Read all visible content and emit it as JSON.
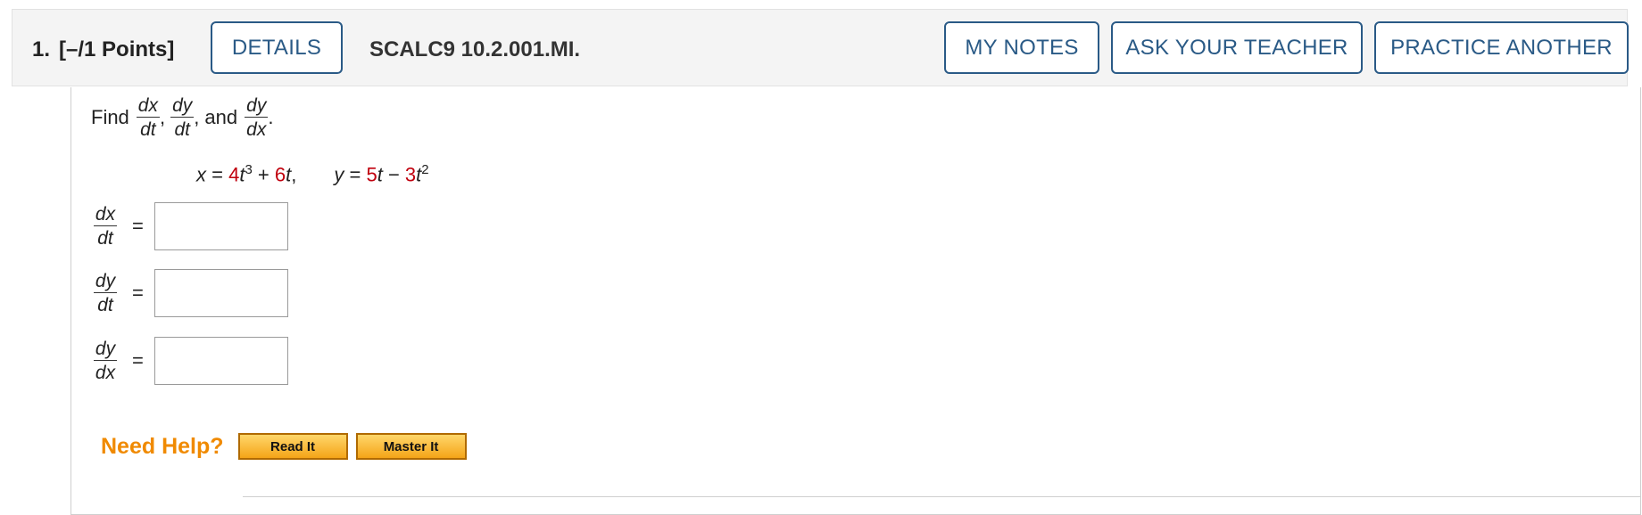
{
  "header": {
    "question_number": "1.",
    "points": "[–/1 Points]",
    "details_label": "DETAILS",
    "question_id": "SCALC9 10.2.001.MI.",
    "my_notes_label": "MY NOTES",
    "ask_teacher_label": "ASK YOUR TEACHER",
    "practice_another_label": "PRACTICE ANOTHER"
  },
  "problem": {
    "find_word": "Find",
    "comma": ",",
    "and_word": "and",
    "period": ".",
    "frac1": {
      "num": "dx",
      "den": "dt"
    },
    "frac2": {
      "num": "dy",
      "den": "dt"
    },
    "frac3": {
      "num": "dy",
      "den": "dx"
    },
    "equation": {
      "x_var": "x",
      "eq1": " = ",
      "coef1": "4",
      "t1": "t",
      "exp1": "3",
      "plus": " + ",
      "coef2": "6",
      "t2": "t",
      "sep": ",",
      "y_var": "y",
      "eq2": " = ",
      "coef3": "5",
      "t3": "t",
      "minus": " − ",
      "coef4": "3",
      "t4": "t",
      "exp2": "2"
    }
  },
  "answers": [
    {
      "num": "dx",
      "den": "dt",
      "eq": "=",
      "value": ""
    },
    {
      "num": "dy",
      "den": "dt",
      "eq": "=",
      "value": ""
    },
    {
      "num": "dy",
      "den": "dx",
      "eq": "=",
      "value": ""
    }
  ],
  "help": {
    "label": "Need Help?",
    "read_it_label": "Read It",
    "master_it_label": "Master It"
  },
  "colors": {
    "accent": "#2a5a86",
    "highlight_red": "#c0000e",
    "help_orange": "#f08a00"
  }
}
